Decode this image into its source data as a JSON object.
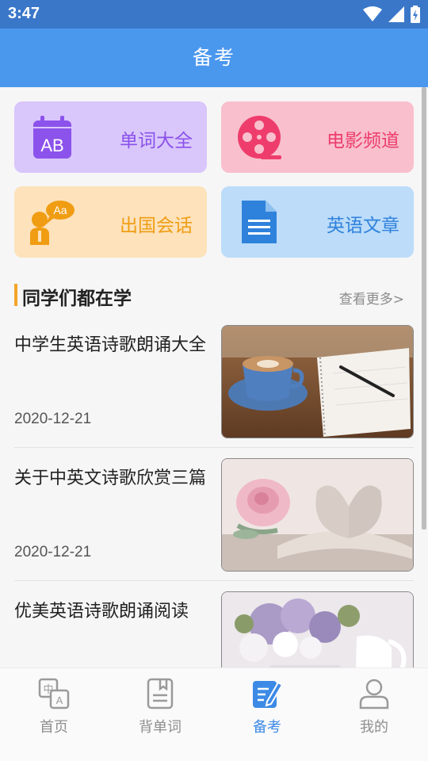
{
  "status_bar": {
    "time": "3:47"
  },
  "header": {
    "title": "备考"
  },
  "tiles": [
    {
      "id": "vocab",
      "label": "单词大全",
      "icon": "ab-calendar-icon",
      "color": "#8a51ea"
    },
    {
      "id": "movie",
      "label": "电影频道",
      "icon": "film-reel-icon",
      "color": "#ec3d6c"
    },
    {
      "id": "abroad",
      "label": "出国会话",
      "icon": "conversation-icon",
      "color": "#f09d13"
    },
    {
      "id": "article",
      "label": "英语文章",
      "icon": "document-icon",
      "color": "#2f82dc"
    }
  ],
  "section": {
    "title": "同学们都在学",
    "more": "查看更多>"
  },
  "articles": [
    {
      "title": "中学生英语诗歌朗诵大全",
      "date": "2020-12-21",
      "image": "coffee-notebook-photo"
    },
    {
      "title": "关于中英文诗歌欣赏三篇",
      "date": "2020-12-21",
      "image": "rose-book-photo"
    },
    {
      "title": "优美英语诗歌朗诵阅读",
      "date": "",
      "image": "lilac-vase-photo"
    }
  ],
  "tab_bar": {
    "tabs": [
      {
        "label": "首页",
        "icon": "translate-icon",
        "active": false
      },
      {
        "label": "背单词",
        "icon": "flashcard-icon",
        "active": false
      },
      {
        "label": "备考",
        "icon": "edit-note-icon",
        "active": true
      },
      {
        "label": "我的",
        "icon": "user-icon",
        "active": false
      }
    ]
  },
  "colors": {
    "header": "#4a97ee",
    "status_bar": "#3a77c9",
    "accent": "#3d8ae6",
    "section_marker": "#f4a52a"
  }
}
